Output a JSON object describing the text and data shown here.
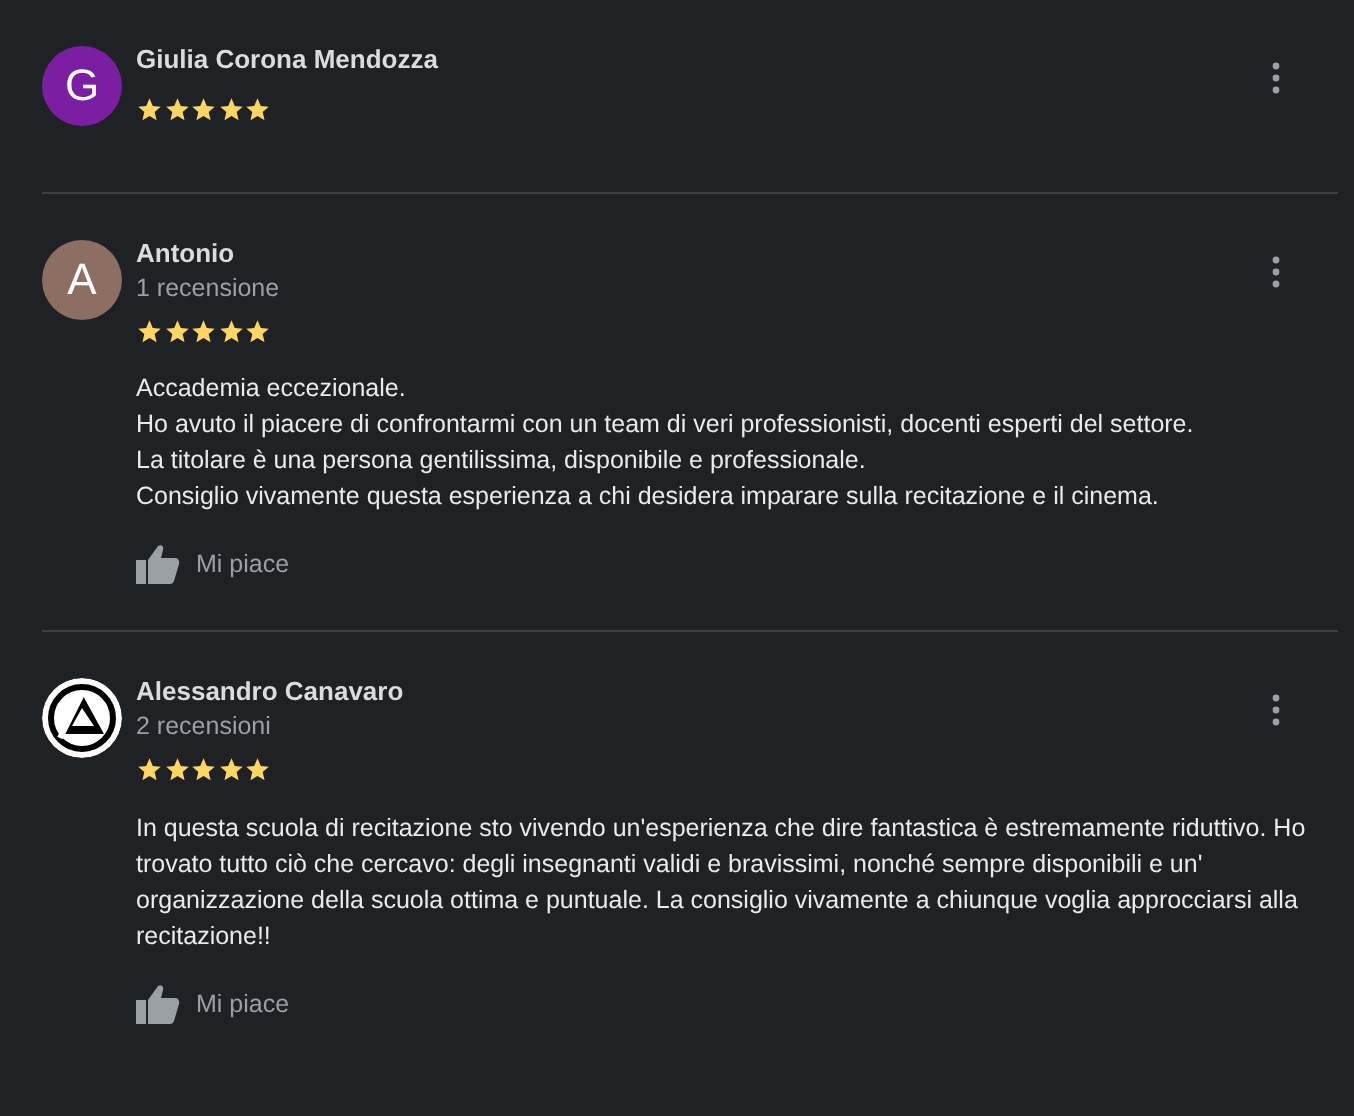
{
  "reviews": [
    {
      "name": "Giulia Corona Mendozza",
      "avatar": {
        "kind": "letter",
        "letter": "G",
        "color": "#7b1fa2"
      },
      "stars": 5
    },
    {
      "name": "Antonio",
      "subtitle": "1 recensione",
      "avatar": {
        "kind": "letter",
        "letter": "A",
        "color": "#8d6e63"
      },
      "stars": 5,
      "text": "Accademia eccezionale.\nHo avuto il piacere di confrontarmi con un team di veri professionisti, docenti esperti del settore.\nLa titolare è una persona gentilissima, disponibile e professionale.\nConsiglio vivamente questa esperienza a chi desidera imparare sulla recitazione e il cinema.",
      "like_label": "Mi piace"
    },
    {
      "name": "Alessandro Canavaro",
      "subtitle": "2 recensioni",
      "avatar": {
        "kind": "logo"
      },
      "stars": 5,
      "text": "In questa scuola di recitazione sto vivendo un'esperienza che dire fantastica è estremamente riduttivo. Ho trovato tutto ciò che cercavo: degli insegnanti validi e bravissimi, nonché sempre disponibili e un' organizzazione della scuola ottima e puntuale. La consiglio vivamente a chiunque voglia approcciarsi alla recitazione!!",
      "like_label": "Mi piace"
    }
  ]
}
